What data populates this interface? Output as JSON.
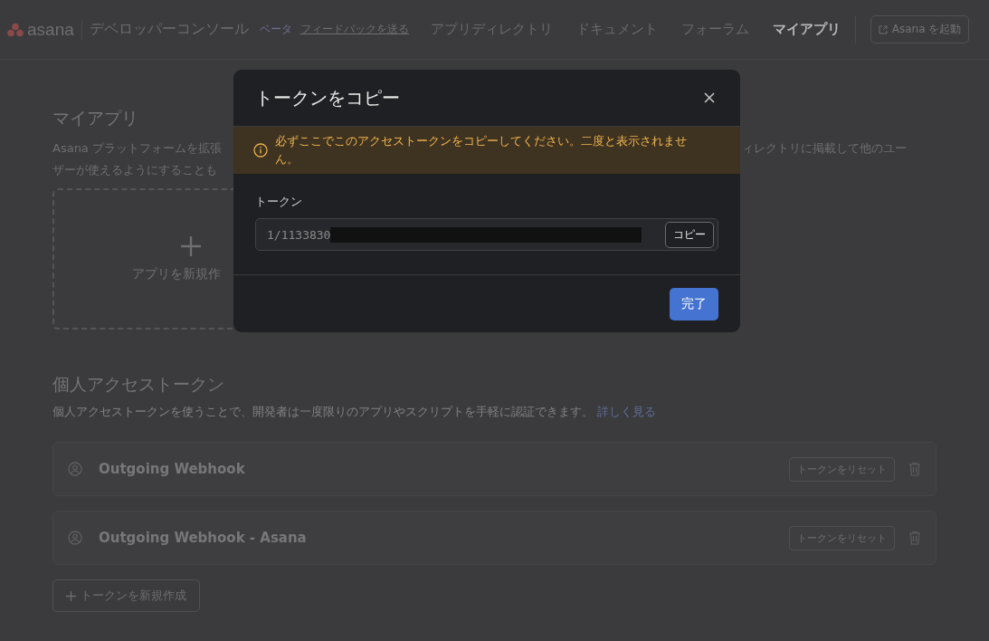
{
  "header": {
    "logo": "asana",
    "console_title": "デベロッパーコンソール",
    "beta": "ベータ",
    "feedback_link": "フィードバックを送る",
    "nav": [
      {
        "label": "アプリディレクトリ",
        "selected": false
      },
      {
        "label": "ドキュメント",
        "selected": false
      },
      {
        "label": "フォーラム",
        "selected": false
      },
      {
        "label": "マイアプリ",
        "selected": true
      }
    ],
    "launch_button": "Asana を起動"
  },
  "my_apps": {
    "title": "マイアプリ",
    "description_left": [
      "Asana プラットフォームを拡張",
      "ザーが使えるようにすることも"
    ],
    "description_right": "ィレクトリに掲載して他のユー",
    "new_app_card": "アプリを新規作"
  },
  "personal_tokens": {
    "title": "個人アクセストークン",
    "description": "個人アクセストークンを使うことで、開発者は一度限りのアプリやスクリプトを手軽に認証できます。",
    "learn_more": "詳しく見る",
    "tokens": [
      {
        "name": "Outgoing Webhook",
        "reset_button": "トークンをリセット"
      },
      {
        "name": "Outgoing Webhook - Asana",
        "reset_button": "トークンをリセット"
      }
    ],
    "new_token_button": "トークンを新規作成"
  },
  "modal": {
    "title": "トークンをコピー",
    "warning": "必ずここでこのアクセストークンをコピーしてください。二度と表示されません。",
    "field_label": "トークン",
    "token_value": "1/1133830",
    "redacted": true,
    "copy_button": "コピー",
    "done_button": "完了"
  }
}
